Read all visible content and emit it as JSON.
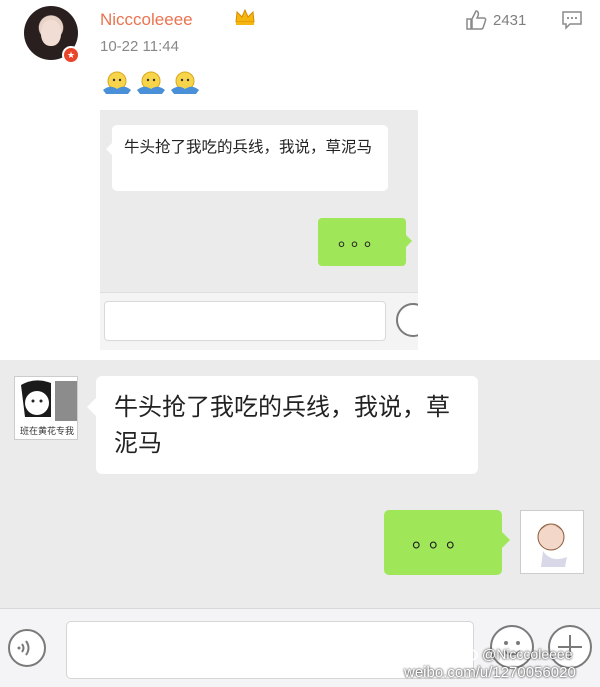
{
  "post": {
    "username": "Nicccoleeee",
    "timestamp": "10-22 11:44",
    "like_count": "2431"
  },
  "chat_small": {
    "incoming_message": "牛头抢了我吃的兵线，我说，草泥马",
    "outgoing_message": "。。。"
  },
  "chat_large": {
    "incoming_message": "牛头抢了我吃的兵线，我说，草泥马",
    "outgoing_message": "。。。",
    "avatar_caption": "班在黄花专我"
  },
  "watermark": {
    "handle": "@Nicccoleeee",
    "url": "weibo.com/u/1270056020"
  },
  "colors": {
    "username": "#eb7350",
    "bubble_outgoing": "#9fe658",
    "chat_background": "#ebebeb"
  },
  "icons": [
    "vip-crown-icon",
    "thumbs-up-icon",
    "comment-icon",
    "emoji-icon",
    "voice-icon",
    "plus-icon",
    "weibo-logo-icon"
  ]
}
